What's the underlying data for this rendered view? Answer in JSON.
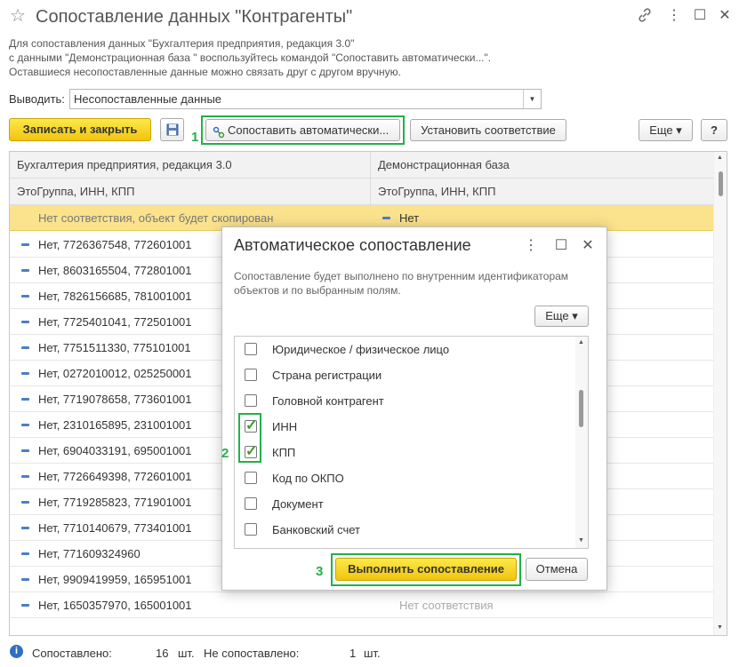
{
  "window": {
    "title": "Сопоставление данных \"Контрагенты\"",
    "star": "☆",
    "link_icon": "🔗",
    "menu_icon": "⋮",
    "maximize_icon": "☐",
    "close_icon": "✕"
  },
  "intro": {
    "line1": "Для сопоставления данных \"Бухгалтерия предприятия, редакция 3.0\"",
    "line2": "с данными \"Демонстрационная база \" воспользуйтесь командой \"Сопоставить автоматически...\".",
    "line3": "Оставшиеся несопоставленные данные можно связать друг с другом вручную."
  },
  "output": {
    "label": "Выводить:",
    "value": "Несопоставленные данные",
    "arrow": "▼"
  },
  "toolbar": {
    "save_close": "Записать и закрыть",
    "save_icon": "💾",
    "auto_match": "Сопоставить автоматически...",
    "set_match": "Установить соответствие",
    "more": "Еще ▾",
    "help": "?"
  },
  "annotations": {
    "n1": "1",
    "n2": "2",
    "n3": "3"
  },
  "table": {
    "col1": "Бухгалтерия предприятия, редакция 3.0",
    "col2": "Демонстрационная база",
    "sub1": "ЭтоГруппа, ИНН, КПП",
    "sub2": "ЭтоГруппа, ИНН, КПП",
    "selected_row": {
      "c1": "Нет соответствия, объект будет скопирован",
      "c2": "Нет"
    },
    "rows": [
      {
        "c1": "Нет, 7726367548, 772601001",
        "c2": ""
      },
      {
        "c1": "Нет, 8603165504, 772801001",
        "c2": ""
      },
      {
        "c1": "Нет, 7826156685, 781001001",
        "c2": ""
      },
      {
        "c1": "Нет, 7725401041, 772501001",
        "c2": ""
      },
      {
        "c1": "Нет, 7751511330, 775101001",
        "c2": ""
      },
      {
        "c1": "Нет, 0272010012, 025250001",
        "c2": ""
      },
      {
        "c1": "Нет, 7719078658, 773601001",
        "c2": ""
      },
      {
        "c1": "Нет, 2310165895, 231001001",
        "c2": ""
      },
      {
        "c1": "Нет, 6904033191, 695001001",
        "c2": ""
      },
      {
        "c1": "Нет, 7726649398, 772601001",
        "c2": ""
      },
      {
        "c1": "Нет, 7719285823, 771901001",
        "c2": ""
      },
      {
        "c1": "Нет, 7710140679, 773401001",
        "c2": ""
      },
      {
        "c1": "Нет, 771609324960",
        "c2": ""
      },
      {
        "c1": "Нет, 9909419959, 165951001",
        "c2": ""
      },
      {
        "c1": "Нет, 1650357970, 165001001",
        "c2": "Нет соответствия"
      }
    ]
  },
  "status": {
    "info_icon": "i",
    "matched_label": "Сопоставлено:",
    "matched_count": "16",
    "unit1": "шт.",
    "unmatched_label": "Не сопоставлено:",
    "unmatched_count": "1",
    "unit2": "шт."
  },
  "dialog": {
    "title": "Автоматическое сопоставление",
    "desc1": "Сопоставление будет выполнено по внутренним идентификаторам",
    "desc2": "объектов и по выбранным полям.",
    "more": "Еще ▾",
    "menu_icon": "⋮",
    "maximize_icon": "☐",
    "close_icon": "✕",
    "fields": [
      {
        "label": "Юридическое / физическое лицо",
        "checked": false
      },
      {
        "label": "Страна регистрации",
        "checked": false
      },
      {
        "label": "Головной контрагент",
        "checked": false
      },
      {
        "label": "ИНН",
        "checked": true
      },
      {
        "label": "КПП",
        "checked": true
      },
      {
        "label": "Код по ОКПО",
        "checked": false
      },
      {
        "label": "Документ",
        "checked": false
      },
      {
        "label": "Банковский счет",
        "checked": false
      }
    ],
    "run": "Выполнить сопоставление",
    "cancel": "Отмена"
  }
}
